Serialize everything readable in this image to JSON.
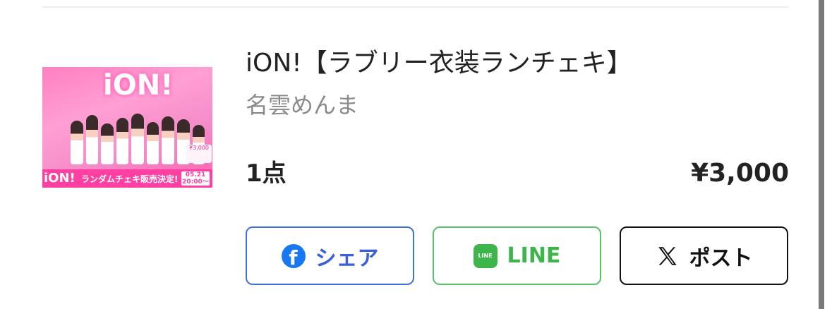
{
  "item": {
    "title": "iON!【ラブリー衣装ランチェキ】",
    "artist": "名雲めんま",
    "quantity": "1点",
    "price": "¥3,000",
    "thumbnail": {
      "logo": "iON!",
      "banner_text": "ランダムチェキ販売決定!",
      "banner_date": "05.21 20:00〜",
      "price_tag": "¥3,000"
    }
  },
  "share": {
    "facebook_label": "シェア",
    "line_label": "LINE",
    "x_label": "ポスト",
    "icons": {
      "facebook": "facebook-icon",
      "line": "line-icon",
      "x": "x-logo-icon"
    },
    "colors": {
      "facebook": "#3b5fd8",
      "line": "#3db54a",
      "x": "#111111"
    }
  }
}
